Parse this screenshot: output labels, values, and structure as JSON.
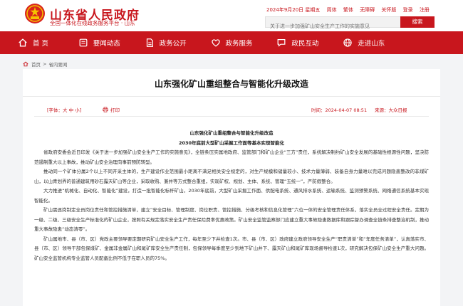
{
  "site": {
    "title": "山东省人民政府",
    "subtitle": "全国一体化在线政务服务平台 · 山东"
  },
  "topbar": {
    "date": "2024年9月20日 星期五",
    "simplified": "简体",
    "traditional": "繁体",
    "accessibility": "无障碍",
    "elderly": "关怀版",
    "login": "登录",
    "register": "注册"
  },
  "search": {
    "placeholder": "关于进一步加强矿山安全生产工作的实施意见",
    "button": "搜索"
  },
  "nav": [
    {
      "label": "首 页",
      "icon": "home-icon"
    },
    {
      "label": "要闻动态",
      "icon": "news-icon"
    },
    {
      "label": "政务公开",
      "icon": "doc-icon"
    },
    {
      "label": "政务服务",
      "icon": "heart-icon"
    },
    {
      "label": "政民互动",
      "icon": "chat-icon"
    },
    {
      "label": "走进山东",
      "icon": "globe-icon"
    }
  ],
  "breadcrumb": {
    "home": "首页",
    "separator": ">",
    "current": "省内要闻"
  },
  "article": {
    "title": "山东强化矿山重组整合与智能化升级改造",
    "font_size_label": "[字体：大 中 小]",
    "print_label": "打印",
    "date": "时间：2024-04-07 08:51",
    "source": "来源：大众日报",
    "subtitle1": "山东强化矿山重组整合与智能化升级改造",
    "subtitle2": "2030年底前大型矿山采掘工作面等基本实现智能化",
    "paragraphs": [
      "省政府安委会近日印发《关于进一步加强矿山安全生产工作的实施意见》，全链条压实属地政府、监管部门和矿山企业“三方”责任，系统解决制约矿山安全发展的基础性根源性问题，坚决防范遏制重大以上事故，推动矿山安全治理向事前预防转型。",
      "推动同一个矿体分属2个以上不同开采主体的，生产建设作业范围最小距离不满足相关安全规定的，对生产规模和储量较小、技术力量薄弱、装备自身力量难以完成问题隐患整改的非煤矿山，以山青划界的普通建筑用砂石露天矿山等企业，采取收购、兼并等方式整合重组，实现矿权、规划、主体、系统、管理“五统一”，严防假整合。",
      "大力推进“机械化、自动化、智能化”建设，打造一批智能化标杆矿山，2030年底前，大型矿山采掘工作面、供配电系统、通风排水系统、运输系统、监测预警系统、网络通信系统基本实现智能化。",
      "矿山需逐岗制定全员岗位责任和管控措施清单，建立“安全目标、管理制度、岗位职责、管控措施、分级考核和信息化管理”六位一体的安全管理责任体系，落实全员全过程安全责任。定期为一级、二级、三级安全生产标准化的矿山企业，按照有关规定落实安全生产责任保险费率优惠政策。矿山安全监管监察部门应建立重大事故隐患数据库和跟踪督办调查全链条排查整治机制，推动重大事故隐患“动态清零”。",
      "矿山属地市、县（市、区）党政主要领导要定期研究矿山安全生产工作，每年至少下井检查1次。市、县（市、区）政府建立政府领导安全生产“职责清单”和“年度任务清单”，认真落实市、县（市、区）领导干部包保煤矿、金属非金属矿山和尾矿库安全生产责任制，包保领导每季度至少到地下矿山井下、露天矿山和尾矿库现场督导检查1次，研究解决包保矿山安全生产重大问题。矿山安全监管机构专业监管人员配备比例不低于在职人员的75%。"
    ]
  },
  "colors": {
    "brand_red": "#c8161d"
  }
}
